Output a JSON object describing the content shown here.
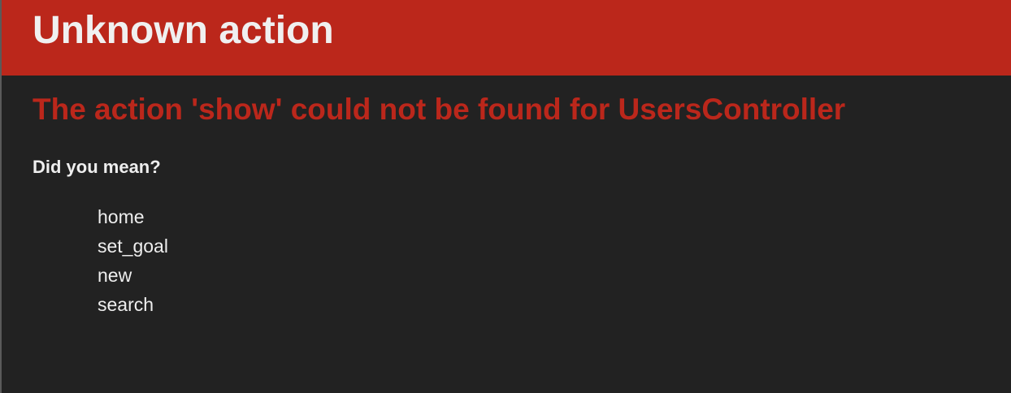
{
  "header": {
    "title": "Unknown action"
  },
  "main": {
    "error_message": "The action 'show' could not be found for UsersController",
    "suggestion_heading": "Did you mean?",
    "suggestions": [
      "home",
      "set_goal",
      "new",
      "search"
    ]
  },
  "colors": {
    "header_bg": "#bb271b",
    "page_bg": "#222222",
    "error_text": "#bb271b",
    "text": "#eeeeee"
  }
}
